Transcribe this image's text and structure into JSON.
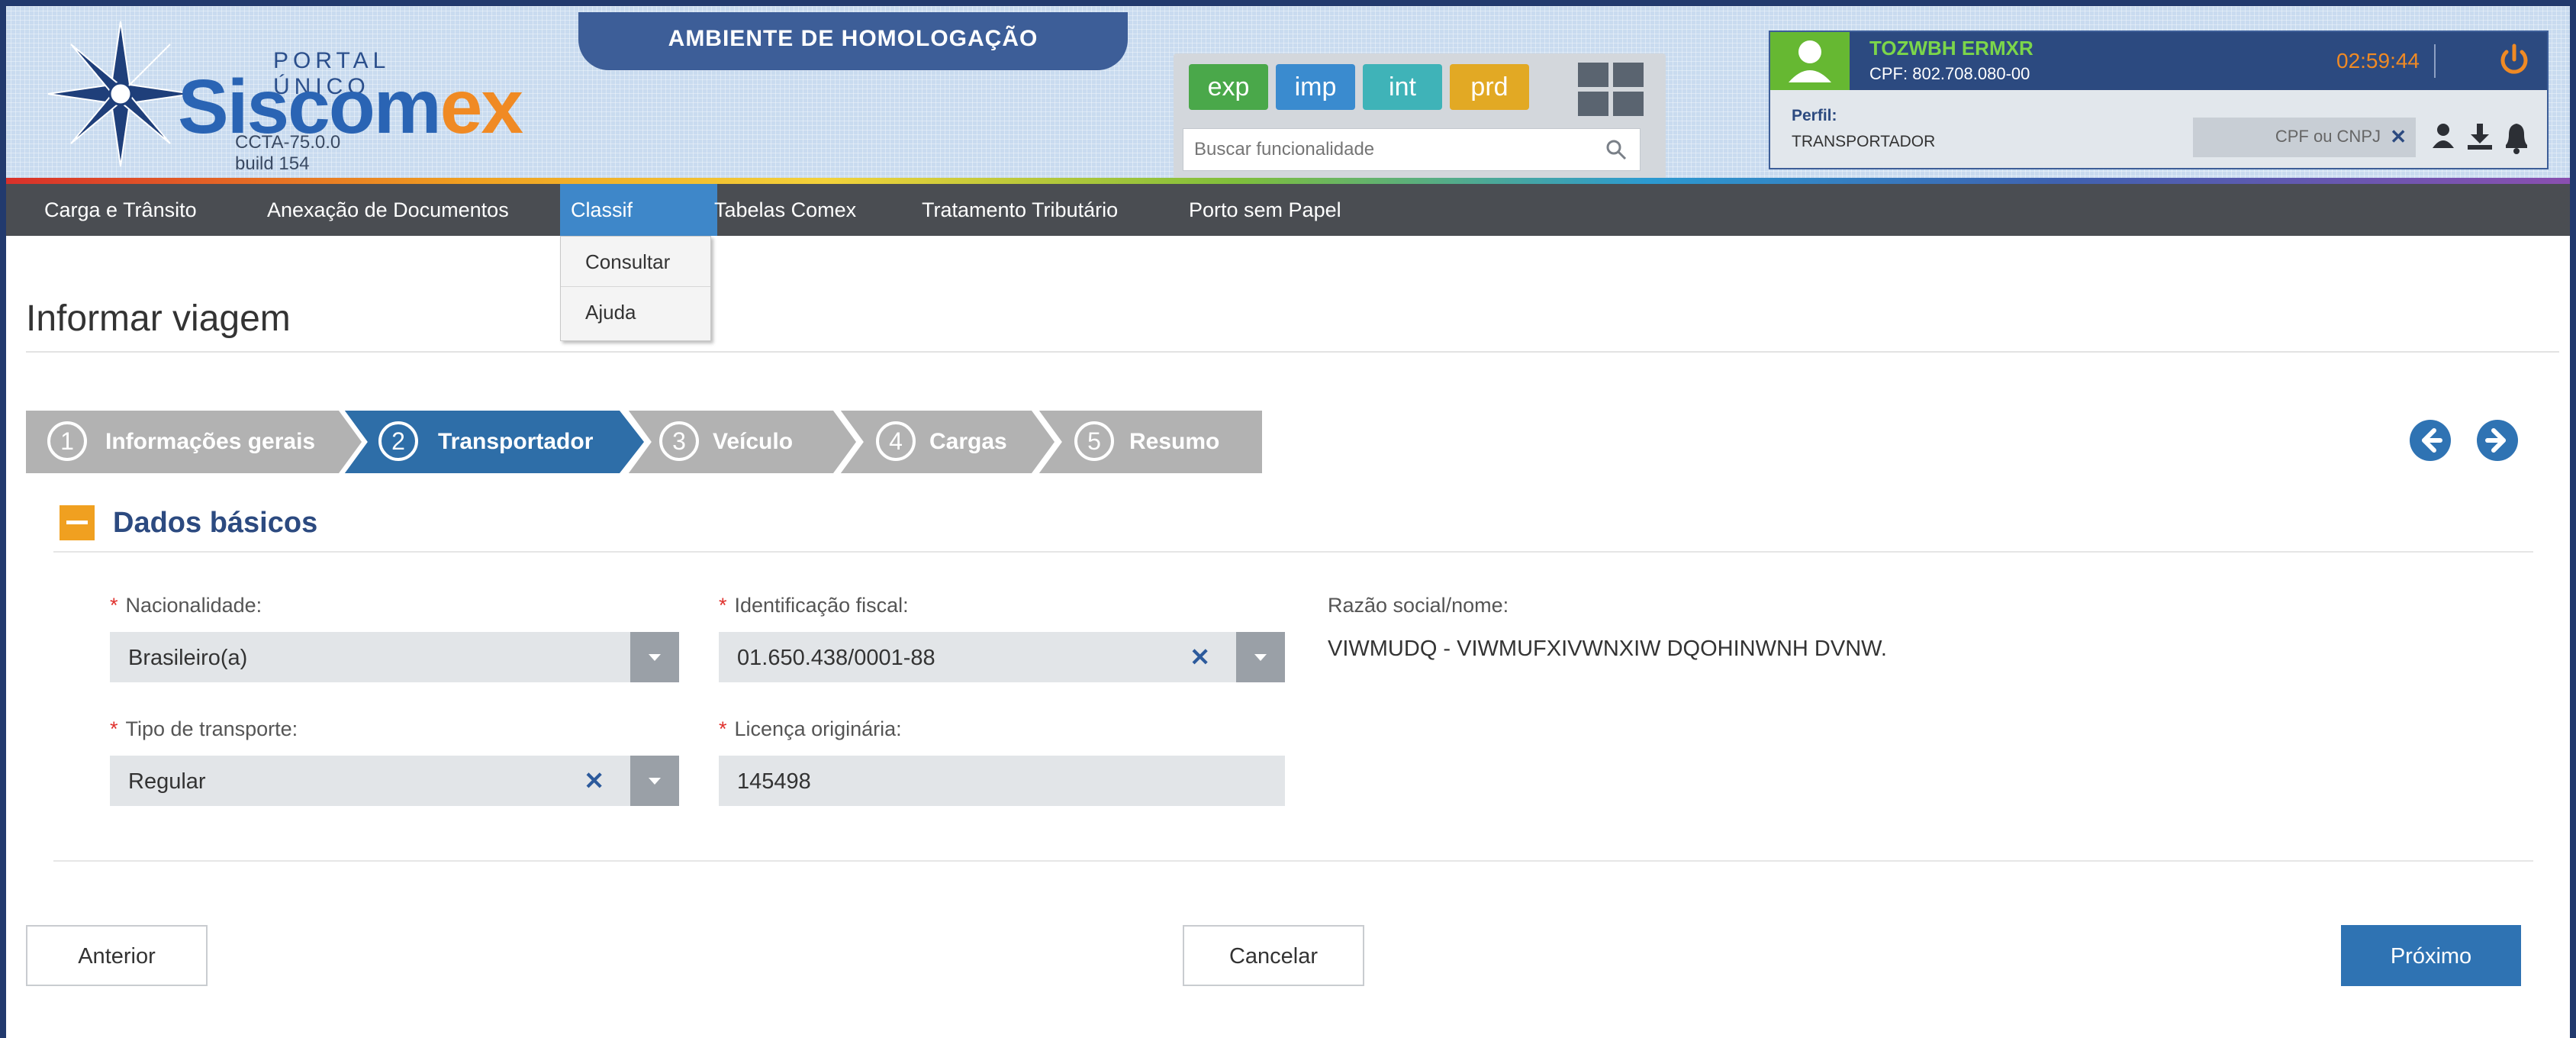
{
  "header": {
    "portal_label": "PORTAL ÚNICO",
    "brand_main": "Siscom",
    "brand_accent": "ex",
    "version": "CCTA-75.0.0",
    "build": "build 154",
    "environment_banner": "AMBIENTE DE HOMOLOGAÇÃO",
    "env_buttons": [
      {
        "label": "exp",
        "color": "#4aa84a"
      },
      {
        "label": "imp",
        "color": "#3a8bcf"
      },
      {
        "label": "int",
        "color": "#3fb3b8"
      },
      {
        "label": "prd",
        "color": "#e2a924"
      }
    ],
    "search": {
      "placeholder": "Buscar funcionalidade"
    },
    "user": {
      "name": "TOZWBH ERMXR",
      "cpf": "CPF: 802.708.080-00",
      "session_time": "02:59:44",
      "perfil_label": "Perfil:",
      "perfil_value": "TRANSPORTADOR",
      "cnpj_placeholder": "CPF ou CNPJ"
    }
  },
  "nav": {
    "items": [
      {
        "label": "Carga e Trânsito"
      },
      {
        "label": "Anexação de Documentos"
      },
      {
        "label": "Classif"
      },
      {
        "label": "Tabelas Comex"
      },
      {
        "label": "Tratamento Tributário"
      },
      {
        "label": "Porto sem Papel"
      }
    ],
    "active_index": 2,
    "dropdown": [
      {
        "label": "Consultar"
      },
      {
        "label": "Ajuda"
      }
    ]
  },
  "page": {
    "title": "Informar viagem",
    "steps": [
      {
        "num": "1",
        "label": "Informações gerais"
      },
      {
        "num": "2",
        "label": "Transportador"
      },
      {
        "num": "3",
        "label": "Veículo"
      },
      {
        "num": "4",
        "label": "Cargas"
      },
      {
        "num": "5",
        "label": "Resumo"
      }
    ],
    "active_step": 2,
    "section_title": "Dados básicos",
    "fields": {
      "nacionalidade": {
        "label": "Nacionalidade:",
        "value": "Brasileiro(a)"
      },
      "identificacao_fiscal": {
        "label": "Identificação fiscal:",
        "value": "01.650.438/0001-88"
      },
      "razao_social": {
        "label": "Razão social/nome:",
        "value": "VIWMUDQ - VIWMUFXIVWNXIW DQOHINWNH DVNW."
      },
      "tipo_transporte": {
        "label": "Tipo de transporte:",
        "value": "Regular"
      },
      "licenca_originaria": {
        "label": "Licença originária:",
        "value": "145498"
      }
    },
    "required_mark": "*",
    "buttons": {
      "previous": "Anterior",
      "cancel": "Cancelar",
      "next": "Próximo"
    }
  },
  "colors": {
    "primary": "#2f73b3",
    "navbar": "#4a4d52",
    "active_tab": "#3e87c9",
    "step_active": "#2e6ea8",
    "step_inactive": "#b2b2b2",
    "accent_orange": "#f08a24"
  },
  "icons": [
    "compass-star-logo",
    "search-icon",
    "user-avatar-icon",
    "power-icon",
    "close-icon",
    "person-icon",
    "download-icon",
    "bell-icon",
    "arrow-left-circle-icon",
    "arrow-right-circle-icon",
    "minus-icon",
    "chevron-down-icon"
  ]
}
